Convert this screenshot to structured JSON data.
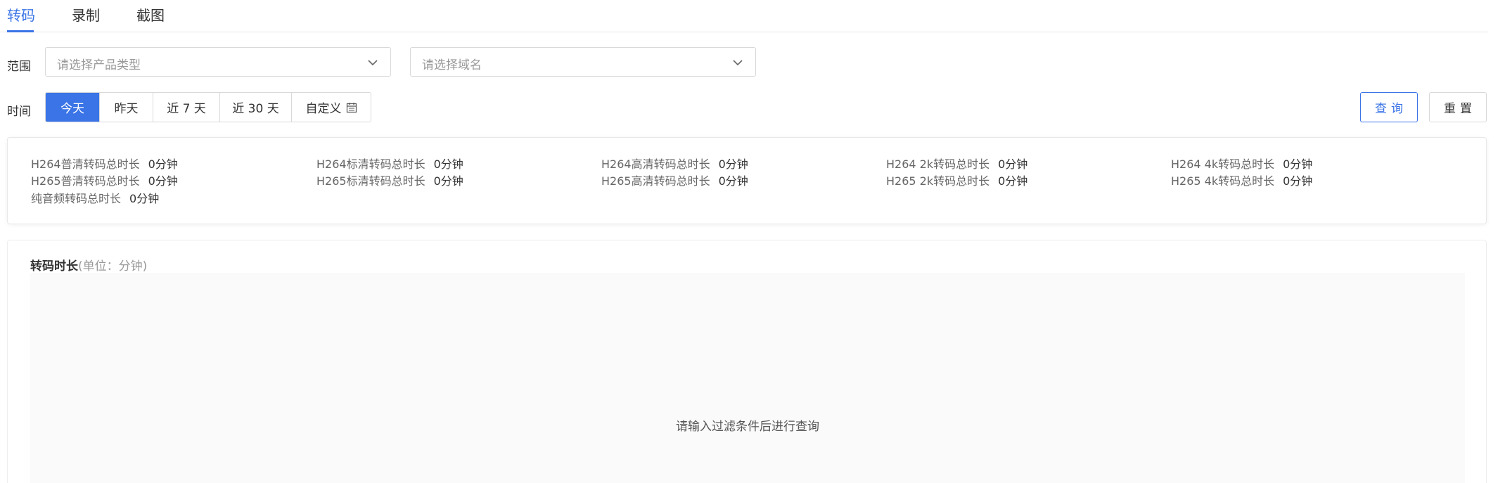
{
  "tabs": [
    {
      "label": "转码",
      "active": true
    },
    {
      "label": "录制",
      "active": false
    },
    {
      "label": "截图",
      "active": false
    }
  ],
  "filters": {
    "scope_label": "范围",
    "product_type_placeholder": "请选择产品类型",
    "domain_placeholder": "请选择域名",
    "time_label": "时间",
    "time_options": [
      {
        "label": "今天",
        "active": true
      },
      {
        "label": "昨天",
        "active": false
      },
      {
        "label": "近 7 天",
        "active": false
      },
      {
        "label": "近 30 天",
        "active": false
      },
      {
        "label": "自定义",
        "active": false
      }
    ],
    "query_label": "查询",
    "reset_label": "重置"
  },
  "summary": [
    {
      "key": "H264普清转码总时长",
      "value": "0分钟"
    },
    {
      "key": "H264标清转码总时长",
      "value": "0分钟"
    },
    {
      "key": "H264高清转码总时长",
      "value": "0分钟"
    },
    {
      "key": "H264 2k转码总时长",
      "value": "0分钟"
    },
    {
      "key": "H264 4k转码总时长",
      "value": "0分钟"
    },
    {
      "key": "H265普清转码总时长",
      "value": "0分钟"
    },
    {
      "key": "H265标清转码总时长",
      "value": "0分钟"
    },
    {
      "key": "H265高清转码总时长",
      "value": "0分钟"
    },
    {
      "key": "H265 2k转码总时长",
      "value": "0分钟"
    },
    {
      "key": "H265 4k转码总时长",
      "value": "0分钟"
    },
    {
      "key": "纯音频转码总时长",
      "value": "0分钟"
    }
  ],
  "panel": {
    "title": "转码时长",
    "unit": "(单位：分钟)",
    "empty_message": "请输入过滤条件后进行查询"
  },
  "colors": {
    "accent": "#3a74e6",
    "chart_bg": "#fafafa"
  }
}
